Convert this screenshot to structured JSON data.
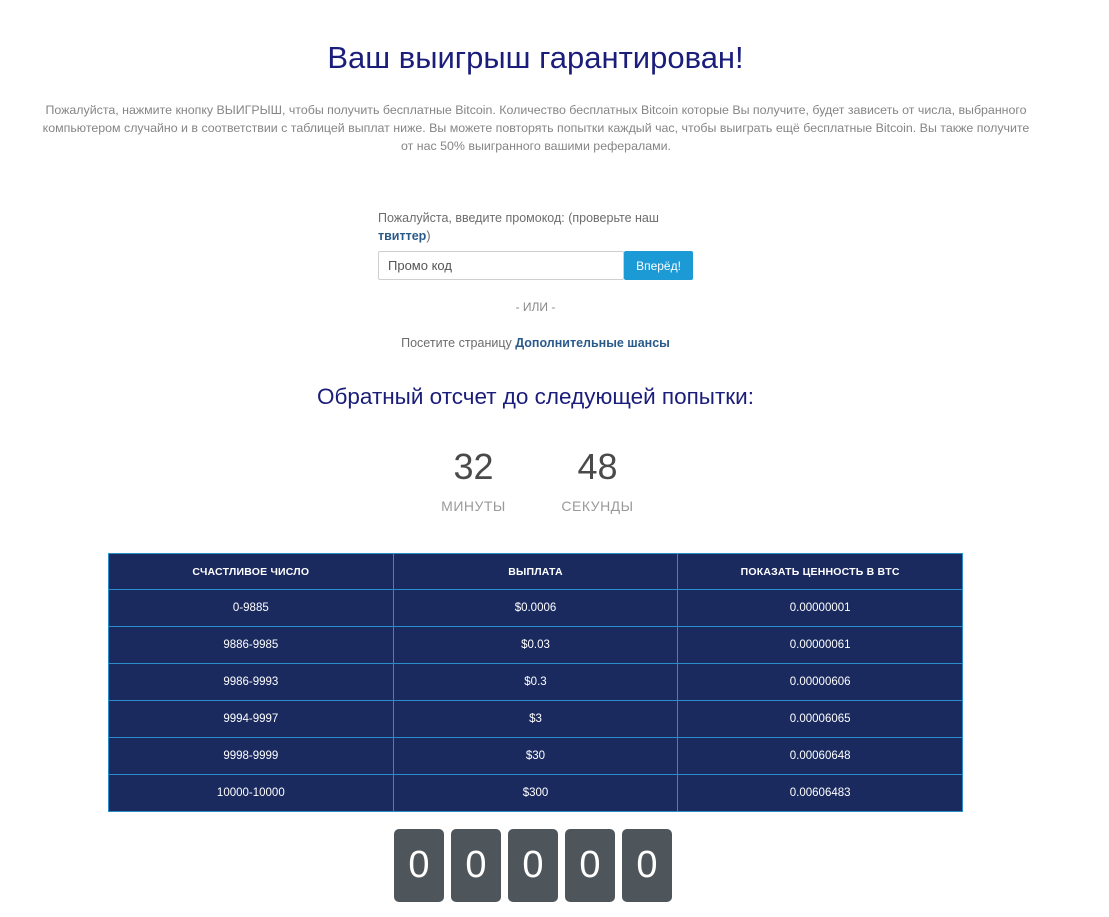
{
  "header": {
    "title": "Ваш выигрыш гарантирован!",
    "intro": "Пожалуйста, нажмите кнопку ВЫИГРЫШ, чтобы получить бесплатные Bitcoin. Количество бесплатных Bitcoin которые Вы получите, будет зависеть от числа, выбранного компьютером случайно и в соответствии с таблицей выплат ниже. Вы можете повторять попытки каждый час, чтобы выиграть ещё бесплатные Bitcoin. Вы также получите от нас 50% выигранного вашими рефералами."
  },
  "promo": {
    "label_prefix": "Пожалуйста, введите промокод: (проверьте наш ",
    "twitter_link": "твиттер",
    "label_suffix": ")",
    "placeholder": "Промо код",
    "button": "Вперёд!"
  },
  "or_text": "- ИЛИ -",
  "visit": {
    "prefix": "Посетите страницу ",
    "link": "Дополнительные шансы"
  },
  "countdown": {
    "title": "Обратный отсчет до следующей попытки:",
    "minutes": "32",
    "minutes_label": "МИНУТЫ",
    "seconds": "48",
    "seconds_label": "СЕКУНДЫ"
  },
  "payout_table": {
    "headers": [
      "СЧАСТЛИВОЕ ЧИСЛО",
      "ВЫПЛАТА",
      "ПОКАЗАТЬ ЦЕННОСТЬ В BTC"
    ],
    "rows": [
      [
        "0-9885",
        "$0.0006",
        "0.00000001"
      ],
      [
        "9886-9985",
        "$0.03",
        "0.00000061"
      ],
      [
        "9986-9993",
        "$0.3",
        "0.00000606"
      ],
      [
        "9994-9997",
        "$3",
        "0.00006065"
      ],
      [
        "9998-9999",
        "$30",
        "0.00060648"
      ],
      [
        "10000-10000",
        "$300",
        "0.00606483"
      ]
    ]
  },
  "digits": [
    "0",
    "0",
    "0",
    "0",
    "0"
  ],
  "colors": {
    "title": "#1a1d7a",
    "table_bg": "#1a2a5e",
    "table_border": "#2a8ccb",
    "button": "#1c9ad6",
    "digit_bg": "#4f565b"
  }
}
